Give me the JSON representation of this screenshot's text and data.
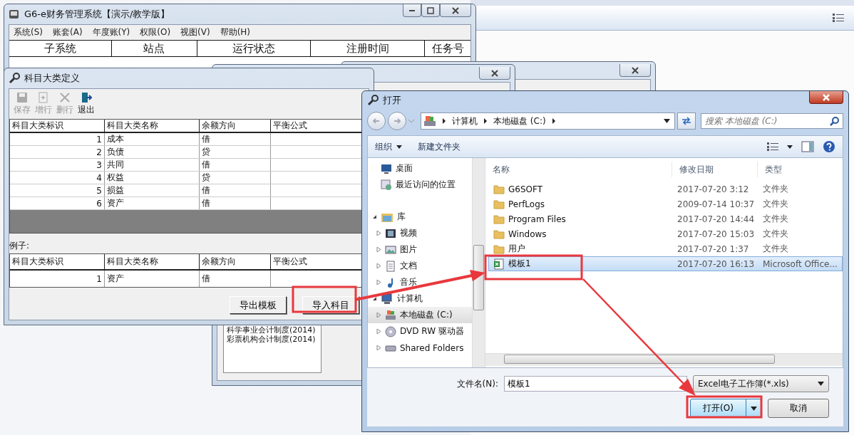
{
  "main_window": {
    "title": "G6-e财务管理系统【演示/教学版】",
    "menu": [
      "系统(S)",
      "账套(A)",
      "年度账(Y)",
      "权限(O)",
      "视图(V)",
      "帮助(H)"
    ],
    "columns": [
      "子系统",
      "站点",
      "运行状态",
      "注册时间",
      "任务号"
    ]
  },
  "background_dialog": {
    "list_items": [
      "科学事业会计制度(2014)",
      "彩票机构会计制度(2014)"
    ]
  },
  "category_window": {
    "title": "科目大类定义",
    "toolbar": [
      {
        "label": "保存",
        "kind": "save",
        "disabled": true
      },
      {
        "label": "增行",
        "kind": "add",
        "disabled": true
      },
      {
        "label": "删行",
        "kind": "delete",
        "disabled": true
      },
      {
        "label": "退出",
        "kind": "exit",
        "disabled": false
      }
    ],
    "columns": [
      "科目大类标识",
      "科目大类名称",
      "余额方向",
      "平衡公式"
    ],
    "rows": [
      {
        "id": "1",
        "name": "成本",
        "direction": "借"
      },
      {
        "id": "2",
        "name": "负债",
        "direction": "贷"
      },
      {
        "id": "3",
        "name": "共同",
        "direction": "借"
      },
      {
        "id": "4",
        "name": "权益",
        "direction": "贷"
      },
      {
        "id": "5",
        "name": "损益",
        "direction": "借"
      },
      {
        "id": "6",
        "name": "资产",
        "direction": "借"
      }
    ],
    "example_label": "例子:",
    "example_columns": [
      "科目大类标识",
      "科目大类名称",
      "余额方向",
      "平衡公式"
    ],
    "example_rows": [
      {
        "id": "1",
        "name": "资产",
        "direction": "借"
      }
    ],
    "buttons": [
      "导出模板",
      "导入科目"
    ]
  },
  "open_dialog": {
    "title": "打开",
    "breadcrumbs": [
      "计算机",
      "本地磁盘 (C:)"
    ],
    "search": {
      "placeholder": "搜索 本地磁盘 (C:)"
    },
    "toolbar": [
      {
        "label": "组织",
        "dropdown": true
      },
      {
        "label": "新建文件夹",
        "dropdown": false
      }
    ],
    "favorites": [
      {
        "label": "桌面",
        "kind": "desktop",
        "selected": false
      },
      {
        "label": "最近访问的位置",
        "kind": "recent",
        "selected": false
      }
    ],
    "groups": [
      {
        "label": "库",
        "kind": "library",
        "expanded": true,
        "selected": false,
        "children": [
          {
            "label": "视频",
            "kind": "video",
            "expanded": false,
            "selected": false
          },
          {
            "label": "图片",
            "kind": "picture",
            "expanded": false,
            "selected": false
          },
          {
            "label": "文档",
            "kind": "document",
            "expanded": false,
            "selected": false
          },
          {
            "label": "音乐",
            "kind": "music",
            "expanded": false,
            "selected": false
          }
        ]
      },
      {
        "label": "计算机",
        "kind": "computer",
        "expanded": true,
        "selected": false,
        "children": [
          {
            "label": "本地磁盘 (C:)",
            "kind": "disk",
            "expanded": false,
            "selected": true
          },
          {
            "label": "DVD RW 驱动器",
            "kind": "dvd",
            "expanded": false,
            "selected": false
          },
          {
            "label": "Shared Folders",
            "kind": "share",
            "expanded": false,
            "selected": false
          }
        ]
      }
    ],
    "columns": [
      "名称",
      "修改日期",
      "类型"
    ],
    "files": [
      {
        "name": "G6SOFT",
        "date": "2017-07-20 3:12",
        "type": "文件夹",
        "kind": "folder",
        "selected": false
      },
      {
        "name": "PerfLogs",
        "date": "2009-07-14 10:37",
        "type": "文件夹",
        "kind": "folder",
        "selected": false
      },
      {
        "name": "Program Files",
        "date": "2017-07-20 14:44",
        "type": "文件夹",
        "kind": "folder",
        "selected": false
      },
      {
        "name": "Windows",
        "date": "2017-07-20 15:03",
        "type": "文件夹",
        "kind": "folder",
        "selected": false
      },
      {
        "name": "用户",
        "date": "2017-07-20 1:37",
        "type": "文件夹",
        "kind": "folder",
        "selected": false
      },
      {
        "name": "模板1",
        "date": "2017-07-20 16:13",
        "type": "Microsoft Office...",
        "kind": "excel",
        "selected": true
      }
    ],
    "filename_label": "文件名(N):",
    "filename": "模板1",
    "file_type": "Excel电子工作簿(*.xls)",
    "open_button": "打开(O)",
    "cancel_button": "取消"
  }
}
